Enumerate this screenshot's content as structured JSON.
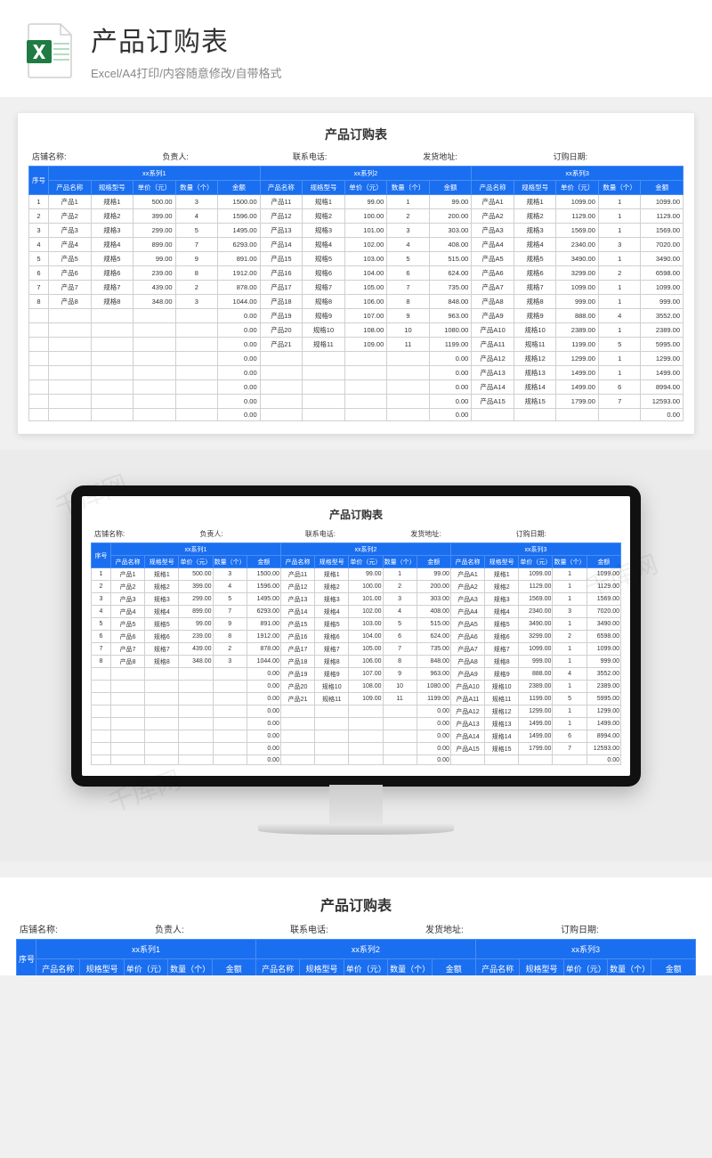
{
  "header": {
    "title": "产品订购表",
    "subtitle": "Excel/A4打印/内容随意修改/自带格式"
  },
  "sheet": {
    "title": "产品订购表",
    "info_labels": {
      "shop": "店铺名称:",
      "manager": "负责人:",
      "phone": "联系电话:",
      "address": "发货地址:",
      "date": "订购日期:"
    },
    "seq_label": "序号",
    "series_headers": [
      "xx系列1",
      "xx系列2",
      "xx系列3"
    ],
    "col_headers": [
      "产品名称",
      "规格型号",
      "单价（元）",
      "数量（个）",
      "金额"
    ],
    "series1": [
      {
        "seq": "1",
        "name": "产品1",
        "spec": "规格1",
        "price": "500.00",
        "qty": "3",
        "amt": "1500.00"
      },
      {
        "seq": "2",
        "name": "产品2",
        "spec": "规格2",
        "price": "399.00",
        "qty": "4",
        "amt": "1596.00"
      },
      {
        "seq": "3",
        "name": "产品3",
        "spec": "规格3",
        "price": "299.00",
        "qty": "5",
        "amt": "1495.00"
      },
      {
        "seq": "4",
        "name": "产品4",
        "spec": "规格4",
        "price": "899.00",
        "qty": "7",
        "amt": "6293.00"
      },
      {
        "seq": "5",
        "name": "产品5",
        "spec": "规格5",
        "price": "99.00",
        "qty": "9",
        "amt": "891.00"
      },
      {
        "seq": "6",
        "name": "产品6",
        "spec": "规格6",
        "price": "239.00",
        "qty": "8",
        "amt": "1912.00"
      },
      {
        "seq": "7",
        "name": "产品7",
        "spec": "规格7",
        "price": "439.00",
        "qty": "2",
        "amt": "878.00"
      },
      {
        "seq": "8",
        "name": "产品8",
        "spec": "规格8",
        "price": "348.00",
        "qty": "3",
        "amt": "1044.00"
      },
      {
        "seq": "",
        "name": "",
        "spec": "",
        "price": "",
        "qty": "",
        "amt": "0.00"
      },
      {
        "seq": "",
        "name": "",
        "spec": "",
        "price": "",
        "qty": "",
        "amt": "0.00"
      },
      {
        "seq": "",
        "name": "",
        "spec": "",
        "price": "",
        "qty": "",
        "amt": "0.00"
      },
      {
        "seq": "",
        "name": "",
        "spec": "",
        "price": "",
        "qty": "",
        "amt": "0.00"
      },
      {
        "seq": "",
        "name": "",
        "spec": "",
        "price": "",
        "qty": "",
        "amt": "0.00"
      },
      {
        "seq": "",
        "name": "",
        "spec": "",
        "price": "",
        "qty": "",
        "amt": "0.00"
      },
      {
        "seq": "",
        "name": "",
        "spec": "",
        "price": "",
        "qty": "",
        "amt": "0.00"
      },
      {
        "seq": "",
        "name": "",
        "spec": "",
        "price": "",
        "qty": "",
        "amt": "0.00"
      }
    ],
    "series2": [
      {
        "name": "产品11",
        "spec": "规格1",
        "price": "99.00",
        "qty": "1",
        "amt": "99.00"
      },
      {
        "name": "产品12",
        "spec": "规格2",
        "price": "100.00",
        "qty": "2",
        "amt": "200.00"
      },
      {
        "name": "产品13",
        "spec": "规格3",
        "price": "101.00",
        "qty": "3",
        "amt": "303.00"
      },
      {
        "name": "产品14",
        "spec": "规格4",
        "price": "102.00",
        "qty": "4",
        "amt": "408.00"
      },
      {
        "name": "产品15",
        "spec": "规格5",
        "price": "103.00",
        "qty": "5",
        "amt": "515.00"
      },
      {
        "name": "产品16",
        "spec": "规格6",
        "price": "104.00",
        "qty": "6",
        "amt": "624.00"
      },
      {
        "name": "产品17",
        "spec": "规格7",
        "price": "105.00",
        "qty": "7",
        "amt": "735.00"
      },
      {
        "name": "产品18",
        "spec": "规格8",
        "price": "106.00",
        "qty": "8",
        "amt": "848.00"
      },
      {
        "name": "产品19",
        "spec": "规格9",
        "price": "107.00",
        "qty": "9",
        "amt": "963.00"
      },
      {
        "name": "产品20",
        "spec": "规格10",
        "price": "108.00",
        "qty": "10",
        "amt": "1080.00"
      },
      {
        "name": "产品21",
        "spec": "规格11",
        "price": "109.00",
        "qty": "11",
        "amt": "1199.00"
      },
      {
        "name": "",
        "spec": "",
        "price": "",
        "qty": "",
        "amt": "0.00"
      },
      {
        "name": "",
        "spec": "",
        "price": "",
        "qty": "",
        "amt": "0.00"
      },
      {
        "name": "",
        "spec": "",
        "price": "",
        "qty": "",
        "amt": "0.00"
      },
      {
        "name": "",
        "spec": "",
        "price": "",
        "qty": "",
        "amt": "0.00"
      },
      {
        "name": "",
        "spec": "",
        "price": "",
        "qty": "",
        "amt": "0.00"
      }
    ],
    "series3": [
      {
        "name": "产品A1",
        "spec": "规格1",
        "price": "1099.00",
        "qty": "1",
        "amt": "1099.00"
      },
      {
        "name": "产品A2",
        "spec": "规格2",
        "price": "1129.00",
        "qty": "1",
        "amt": "1129.00"
      },
      {
        "name": "产品A3",
        "spec": "规格3",
        "price": "1569.00",
        "qty": "1",
        "amt": "1569.00"
      },
      {
        "name": "产品A4",
        "spec": "规格4",
        "price": "2340.00",
        "qty": "3",
        "amt": "7020.00"
      },
      {
        "name": "产品A5",
        "spec": "规格5",
        "price": "3490.00",
        "qty": "1",
        "amt": "3490.00"
      },
      {
        "name": "产品A6",
        "spec": "规格6",
        "price": "3299.00",
        "qty": "2",
        "amt": "6598.00"
      },
      {
        "name": "产品A7",
        "spec": "规格7",
        "price": "1099.00",
        "qty": "1",
        "amt": "1099.00"
      },
      {
        "name": "产品A8",
        "spec": "规格8",
        "price": "999.00",
        "qty": "1",
        "amt": "999.00"
      },
      {
        "name": "产品A9",
        "spec": "规格9",
        "price": "888.00",
        "qty": "4",
        "amt": "3552.00"
      },
      {
        "name": "产品A10",
        "spec": "规格10",
        "price": "2389.00",
        "qty": "1",
        "amt": "2389.00"
      },
      {
        "name": "产品A11",
        "spec": "规格11",
        "price": "1199.00",
        "qty": "5",
        "amt": "5995.00"
      },
      {
        "name": "产品A12",
        "spec": "规格12",
        "price": "1299.00",
        "qty": "1",
        "amt": "1299.00"
      },
      {
        "name": "产品A13",
        "spec": "规格13",
        "price": "1499.00",
        "qty": "1",
        "amt": "1499.00"
      },
      {
        "name": "产品A14",
        "spec": "规格14",
        "price": "1499.00",
        "qty": "6",
        "amt": "8994.00"
      },
      {
        "name": "产品A15",
        "spec": "规格15",
        "price": "1799.00",
        "qty": "7",
        "amt": "12593.00"
      },
      {
        "name": "",
        "spec": "",
        "price": "",
        "qty": "",
        "amt": "0.00"
      }
    ]
  },
  "watermark": "千库网"
}
